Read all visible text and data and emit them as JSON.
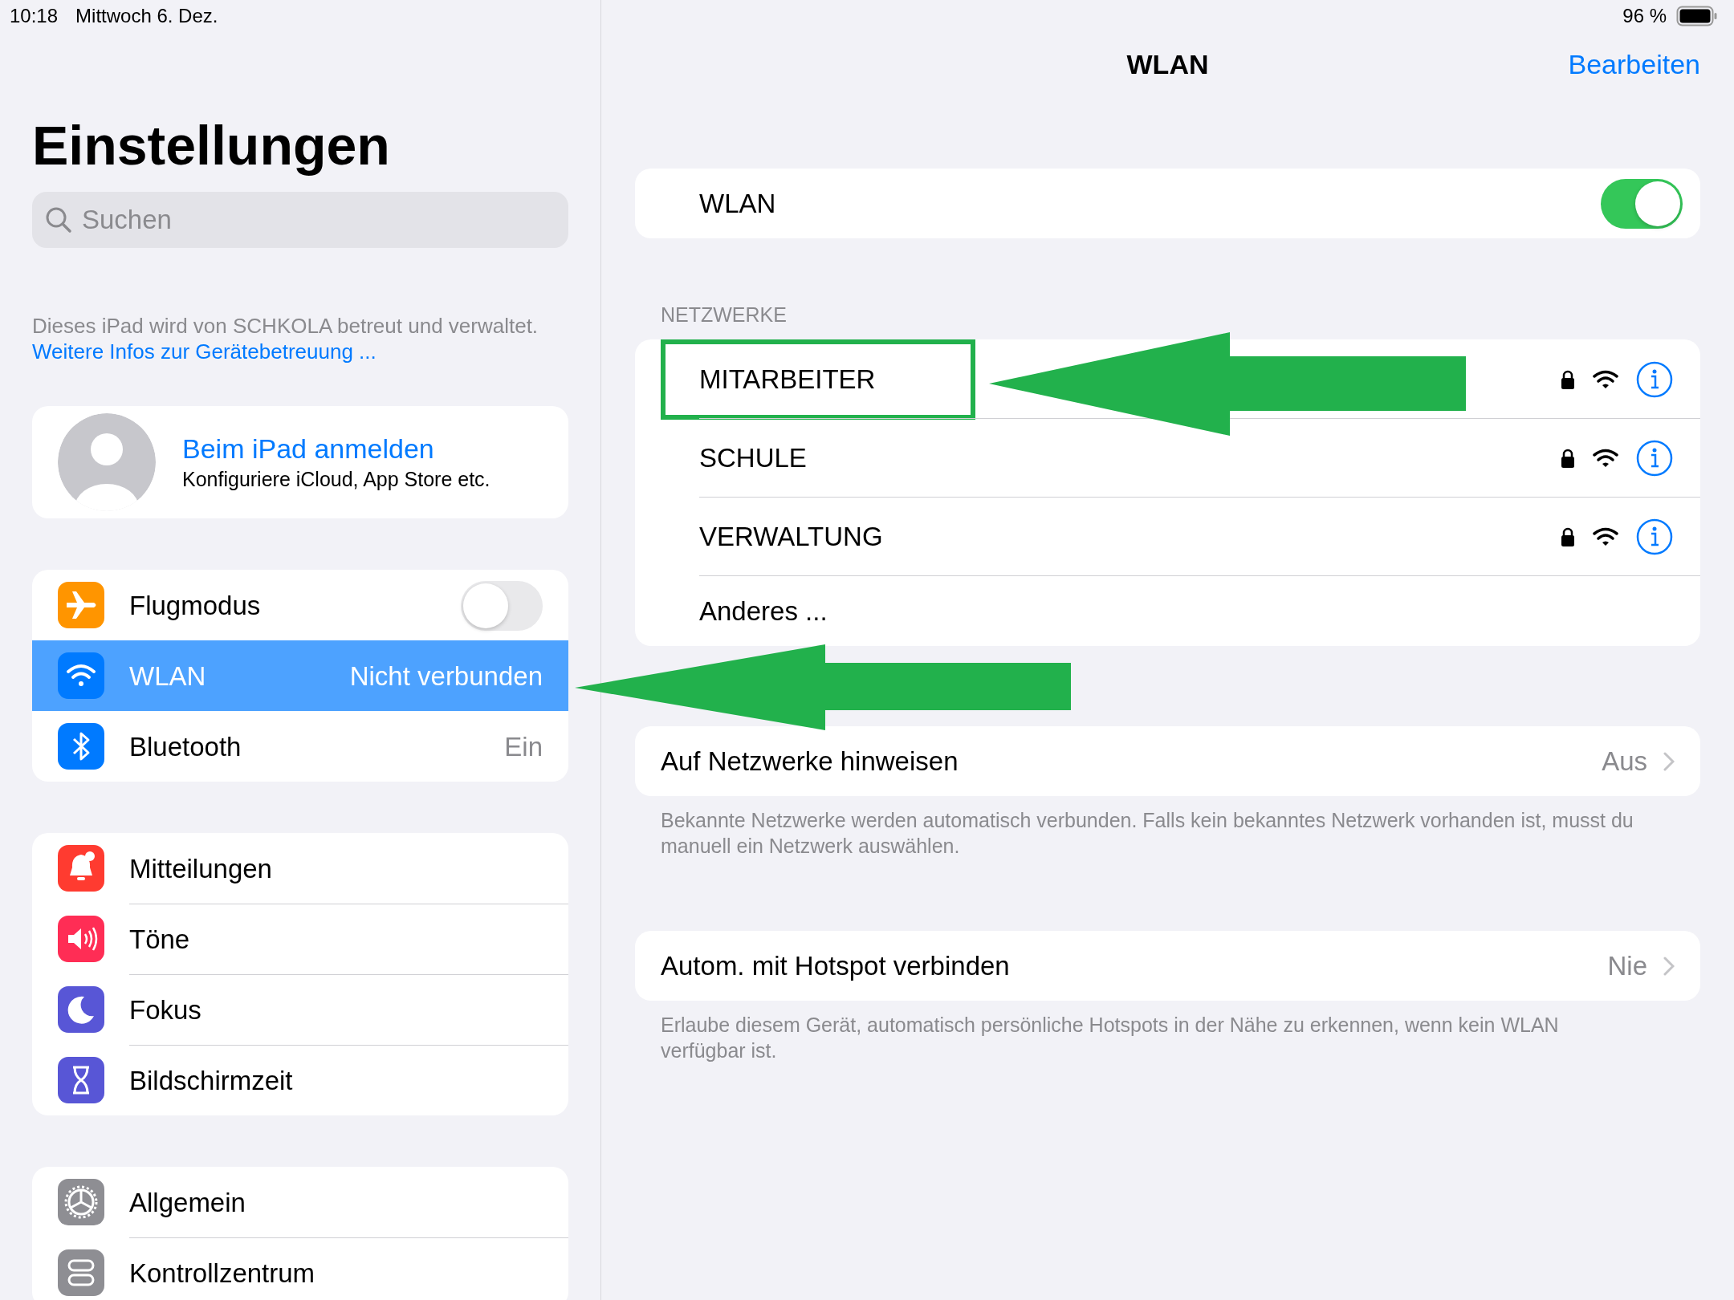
{
  "status_bar": {
    "time": "10:18",
    "date": "Mittwoch 6. Dez.",
    "battery": "96 %"
  },
  "sidebar": {
    "title": "Einstellungen",
    "search": {
      "placeholder": "Suchen"
    },
    "management_note": {
      "text": "Dieses iPad wird von SCHKOLA betreut und verwaltet.",
      "link": "Weitere Infos zur Gerätebetreuung ..."
    },
    "account": {
      "title": "Beim iPad anmelden",
      "subtitle": "Konfiguriere iCloud, App Store etc."
    },
    "groups": [
      [
        {
          "label": "Flugmodus",
          "kind": "toggle",
          "on": false,
          "selected": false,
          "color": "#ff9500"
        },
        {
          "label": "WLAN",
          "kind": "value",
          "value": "Nicht verbunden",
          "selected": true,
          "color": "#007aff"
        },
        {
          "label": "Bluetooth",
          "kind": "value",
          "value": "Ein",
          "selected": false,
          "color": "#007aff"
        }
      ],
      [
        {
          "label": "Mitteilungen",
          "kind": "plain",
          "selected": false,
          "color": "#ff3b30"
        },
        {
          "label": "Töne",
          "kind": "plain",
          "selected": false,
          "color": "#ff2d55"
        },
        {
          "label": "Fokus",
          "kind": "plain",
          "selected": false,
          "color": "#5856d6"
        },
        {
          "label": "Bildschirmzeit",
          "kind": "plain",
          "selected": false,
          "color": "#5856d6"
        }
      ],
      [
        {
          "label": "Allgemein",
          "kind": "plain",
          "selected": false,
          "color": "#8e8e93"
        },
        {
          "label": "Kontrollzentrum",
          "kind": "plain",
          "selected": false,
          "color": "#8e8e93"
        }
      ]
    ]
  },
  "nav": {
    "title": "WLAN",
    "edit_button": "Bearbeiten"
  },
  "wifi": {
    "label": "WLAN",
    "on": true
  },
  "networks": {
    "header": "NETZWERKE",
    "items": [
      {
        "name": "MITARBEITER",
        "kind": "network",
        "highlighted": true
      },
      {
        "name": "SCHULE",
        "kind": "network",
        "highlighted": false
      },
      {
        "name": "VERWALTUNG",
        "kind": "network",
        "highlighted": false
      },
      {
        "name": "Anderes ...",
        "kind": "other",
        "highlighted": false
      }
    ]
  },
  "settings": [
    {
      "label": "Auf Netzwerke hinweisen",
      "value": "Aus",
      "note": "Bekannte Netzwerke werden automatisch verbunden. Falls kein bekanntes Netzwerk vorhanden ist, musst du manuell ein Netzwerk auswählen."
    },
    {
      "label": "Autom. mit Hotspot verbinden",
      "value": "Nie",
      "note": "Erlaube diesem Gerät, automatisch persönliche Hotspots in der Nähe zu erkennen, wenn kein WLAN verfügbar ist."
    }
  ]
}
